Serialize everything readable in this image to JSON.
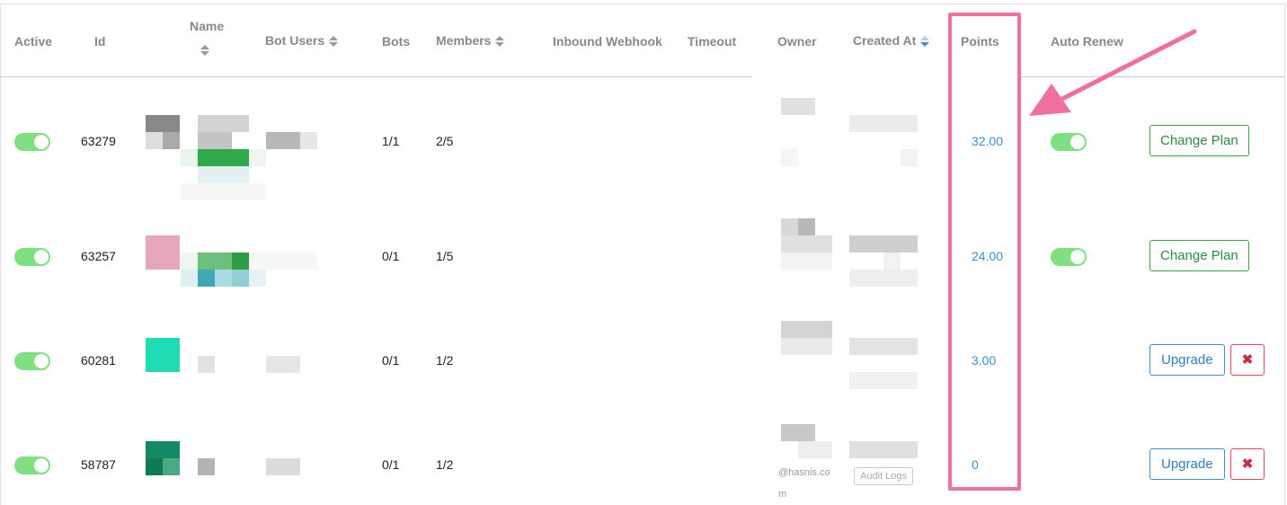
{
  "columns": {
    "active": "Active",
    "id": "Id",
    "name": "Name",
    "bot_users": "Bot Users",
    "bots": "Bots",
    "members": "Members",
    "inbound_webhook": "Inbound Webhook",
    "timeout": "Timeout",
    "owner": "Owner",
    "created_at": "Created At",
    "points": "Points",
    "auto_renew": "Auto Renew"
  },
  "rows": [
    {
      "active": true,
      "id": "63279",
      "bots": "1/1",
      "members": "2/5",
      "points": "32.00",
      "auto_renew": true,
      "action": "Change Plan"
    },
    {
      "active": true,
      "id": "63257",
      "bots": "0/1",
      "members": "1/5",
      "points": "24.00",
      "auto_renew": true,
      "action": "Change Plan"
    },
    {
      "active": true,
      "id": "60281",
      "bots": "0/1",
      "members": "1/2",
      "points": "3.00",
      "action": "Upgrade",
      "delete_icon": "✖"
    },
    {
      "active": true,
      "id": "58787",
      "bots": "0/1",
      "members": "1/2",
      "points": "0",
      "action": "Upgrade",
      "delete_icon": "✖"
    }
  ],
  "partial": {
    "owner_email_fragment": "@hasnis.co",
    "owner_email_end": "m",
    "audit_logs": "Audit Logs"
  },
  "colors": {
    "toggle_on": "#7ee080",
    "points_text": "#3a8fd1",
    "highlight": "#ef6f9f",
    "change_plan": "#3aa14a",
    "upgrade": "#3a8fd1",
    "delete": "#d94a5a"
  }
}
